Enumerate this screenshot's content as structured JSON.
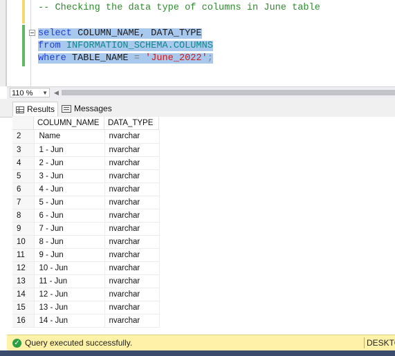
{
  "editor": {
    "comment": "-- Checking the data type of columns in June table",
    "line1": {
      "kw": "select",
      "rest": " COLUMN_NAME, DATA_TYPE"
    },
    "line2": {
      "kw": "from",
      "obj": "INFORMATION_SCHEMA.COLUMNS"
    },
    "line3": {
      "kw": "where",
      "col": " TABLE_NAME ",
      "op": "=",
      "str": "'June_2022'",
      "semi": ";"
    }
  },
  "zoom": {
    "value": "110 %"
  },
  "tabs": {
    "results": "Results",
    "messages": "Messages"
  },
  "grid": {
    "headers": [
      "COLUMN_NAME",
      "DATA_TYPE"
    ],
    "rows": [
      [
        "2",
        "Name",
        "nvarchar"
      ],
      [
        "3",
        "1 - Jun",
        "nvarchar"
      ],
      [
        "4",
        "2 - Jun",
        "nvarchar"
      ],
      [
        "5",
        "3 - Jun",
        "nvarchar"
      ],
      [
        "6",
        "4 - Jun",
        "nvarchar"
      ],
      [
        "7",
        "5 - Jun",
        "nvarchar"
      ],
      [
        "8",
        "6 - Jun",
        "nvarchar"
      ],
      [
        "9",
        "7 - Jun",
        "nvarchar"
      ],
      [
        "10",
        "8 - Jun",
        "nvarchar"
      ],
      [
        "11",
        "9 - Jun",
        "nvarchar"
      ],
      [
        "12",
        "10 - Jun",
        "nvarchar"
      ],
      [
        "13",
        "11 - Jun",
        "nvarchar"
      ],
      [
        "14",
        "12 - Jun",
        "nvarchar"
      ],
      [
        "15",
        "13 - Jun",
        "nvarchar"
      ],
      [
        "16",
        "14 - Jun",
        "nvarchar"
      ]
    ]
  },
  "status": {
    "message": "Query executed successfully.",
    "server": "DESKTO"
  }
}
